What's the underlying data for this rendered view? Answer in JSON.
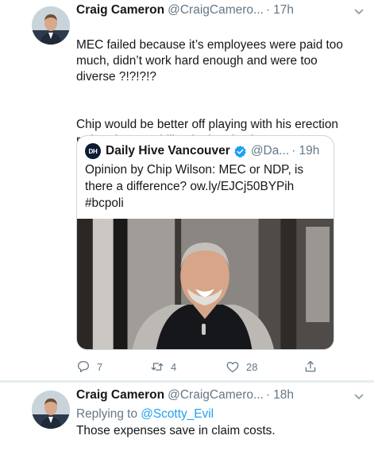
{
  "tweet1": {
    "name": "Craig Cameron",
    "handle": "@CraigCamero...",
    "dot": "·",
    "time": "17h",
    "paragraph1": "MEC failed because it’s employees were paid too much, didn’t work hard enough and were too diverse ?!?!?!?",
    "paragraph2": "Chip would be better off playing with his erection rather than meddling in the election.",
    "quote": {
      "avatar_text": "DH",
      "name": "Daily Hive Vancouver",
      "handle": "@Da...",
      "dot": "·",
      "time": "19h",
      "text": "Opinion by Chip Wilson: MEC or NDP, is there a difference? ow.ly/EJCj50BYPih #bcpoli"
    },
    "actions": {
      "reply_count": "7",
      "retweet_count": "4",
      "like_count": "28"
    }
  },
  "tweet2": {
    "name": "Craig Cameron",
    "handle": "@CraigCamero...",
    "dot": "·",
    "time": "18h",
    "replying_prefix": "Replying to ",
    "replying_to": "@Scotty_Evil",
    "text": "Those expenses save in claim costs."
  },
  "colors": {
    "link": "#1da1f2",
    "secondary": "#657786",
    "verified": "#1da1f2",
    "divider": "#e6ecf0"
  },
  "icons": [
    "caret-down-icon",
    "verified-badge-icon",
    "reply-icon",
    "retweet-icon",
    "like-icon",
    "share-icon"
  ]
}
